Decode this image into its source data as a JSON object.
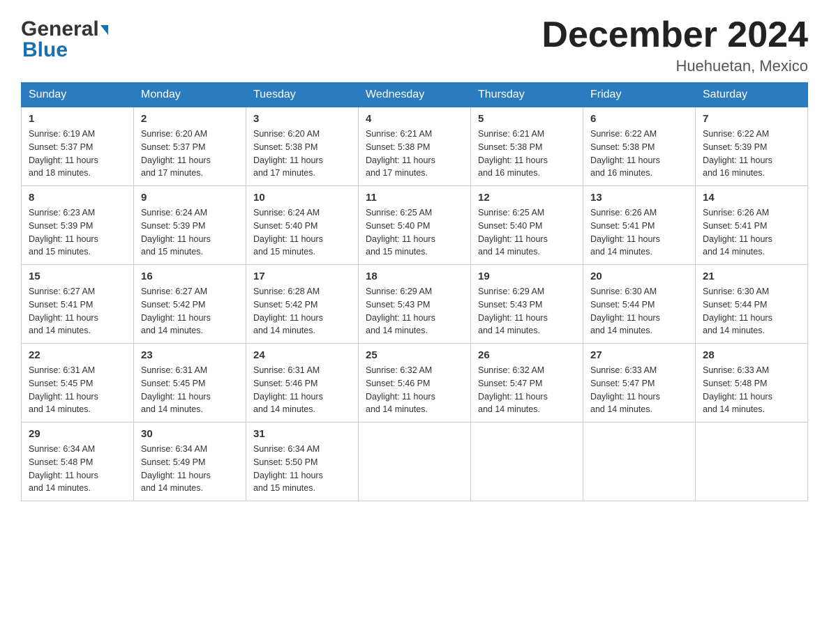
{
  "header": {
    "logo_general": "General",
    "logo_blue": "Blue",
    "title": "December 2024",
    "location": "Huehuetan, Mexico"
  },
  "weekdays": [
    "Sunday",
    "Monday",
    "Tuesday",
    "Wednesday",
    "Thursday",
    "Friday",
    "Saturday"
  ],
  "weeks": [
    [
      {
        "day": "1",
        "sunrise": "6:19 AM",
        "sunset": "5:37 PM",
        "daylight": "11 hours and 18 minutes."
      },
      {
        "day": "2",
        "sunrise": "6:20 AM",
        "sunset": "5:37 PM",
        "daylight": "11 hours and 17 minutes."
      },
      {
        "day": "3",
        "sunrise": "6:20 AM",
        "sunset": "5:38 PM",
        "daylight": "11 hours and 17 minutes."
      },
      {
        "day": "4",
        "sunrise": "6:21 AM",
        "sunset": "5:38 PM",
        "daylight": "11 hours and 17 minutes."
      },
      {
        "day": "5",
        "sunrise": "6:21 AM",
        "sunset": "5:38 PM",
        "daylight": "11 hours and 16 minutes."
      },
      {
        "day": "6",
        "sunrise": "6:22 AM",
        "sunset": "5:38 PM",
        "daylight": "11 hours and 16 minutes."
      },
      {
        "day": "7",
        "sunrise": "6:22 AM",
        "sunset": "5:39 PM",
        "daylight": "11 hours and 16 minutes."
      }
    ],
    [
      {
        "day": "8",
        "sunrise": "6:23 AM",
        "sunset": "5:39 PM",
        "daylight": "11 hours and 15 minutes."
      },
      {
        "day": "9",
        "sunrise": "6:24 AM",
        "sunset": "5:39 PM",
        "daylight": "11 hours and 15 minutes."
      },
      {
        "day": "10",
        "sunrise": "6:24 AM",
        "sunset": "5:40 PM",
        "daylight": "11 hours and 15 minutes."
      },
      {
        "day": "11",
        "sunrise": "6:25 AM",
        "sunset": "5:40 PM",
        "daylight": "11 hours and 15 minutes."
      },
      {
        "day": "12",
        "sunrise": "6:25 AM",
        "sunset": "5:40 PM",
        "daylight": "11 hours and 14 minutes."
      },
      {
        "day": "13",
        "sunrise": "6:26 AM",
        "sunset": "5:41 PM",
        "daylight": "11 hours and 14 minutes."
      },
      {
        "day": "14",
        "sunrise": "6:26 AM",
        "sunset": "5:41 PM",
        "daylight": "11 hours and 14 minutes."
      }
    ],
    [
      {
        "day": "15",
        "sunrise": "6:27 AM",
        "sunset": "5:41 PM",
        "daylight": "11 hours and 14 minutes."
      },
      {
        "day": "16",
        "sunrise": "6:27 AM",
        "sunset": "5:42 PM",
        "daylight": "11 hours and 14 minutes."
      },
      {
        "day": "17",
        "sunrise": "6:28 AM",
        "sunset": "5:42 PM",
        "daylight": "11 hours and 14 minutes."
      },
      {
        "day": "18",
        "sunrise": "6:29 AM",
        "sunset": "5:43 PM",
        "daylight": "11 hours and 14 minutes."
      },
      {
        "day": "19",
        "sunrise": "6:29 AM",
        "sunset": "5:43 PM",
        "daylight": "11 hours and 14 minutes."
      },
      {
        "day": "20",
        "sunrise": "6:30 AM",
        "sunset": "5:44 PM",
        "daylight": "11 hours and 14 minutes."
      },
      {
        "day": "21",
        "sunrise": "6:30 AM",
        "sunset": "5:44 PM",
        "daylight": "11 hours and 14 minutes."
      }
    ],
    [
      {
        "day": "22",
        "sunrise": "6:31 AM",
        "sunset": "5:45 PM",
        "daylight": "11 hours and 14 minutes."
      },
      {
        "day": "23",
        "sunrise": "6:31 AM",
        "sunset": "5:45 PM",
        "daylight": "11 hours and 14 minutes."
      },
      {
        "day": "24",
        "sunrise": "6:31 AM",
        "sunset": "5:46 PM",
        "daylight": "11 hours and 14 minutes."
      },
      {
        "day": "25",
        "sunrise": "6:32 AM",
        "sunset": "5:46 PM",
        "daylight": "11 hours and 14 minutes."
      },
      {
        "day": "26",
        "sunrise": "6:32 AM",
        "sunset": "5:47 PM",
        "daylight": "11 hours and 14 minutes."
      },
      {
        "day": "27",
        "sunrise": "6:33 AM",
        "sunset": "5:47 PM",
        "daylight": "11 hours and 14 minutes."
      },
      {
        "day": "28",
        "sunrise": "6:33 AM",
        "sunset": "5:48 PM",
        "daylight": "11 hours and 14 minutes."
      }
    ],
    [
      {
        "day": "29",
        "sunrise": "6:34 AM",
        "sunset": "5:48 PM",
        "daylight": "11 hours and 14 minutes."
      },
      {
        "day": "30",
        "sunrise": "6:34 AM",
        "sunset": "5:49 PM",
        "daylight": "11 hours and 14 minutes."
      },
      {
        "day": "31",
        "sunrise": "6:34 AM",
        "sunset": "5:50 PM",
        "daylight": "11 hours and 15 minutes."
      },
      null,
      null,
      null,
      null
    ]
  ],
  "labels": {
    "sunrise": "Sunrise:",
    "sunset": "Sunset:",
    "daylight": "Daylight:"
  }
}
